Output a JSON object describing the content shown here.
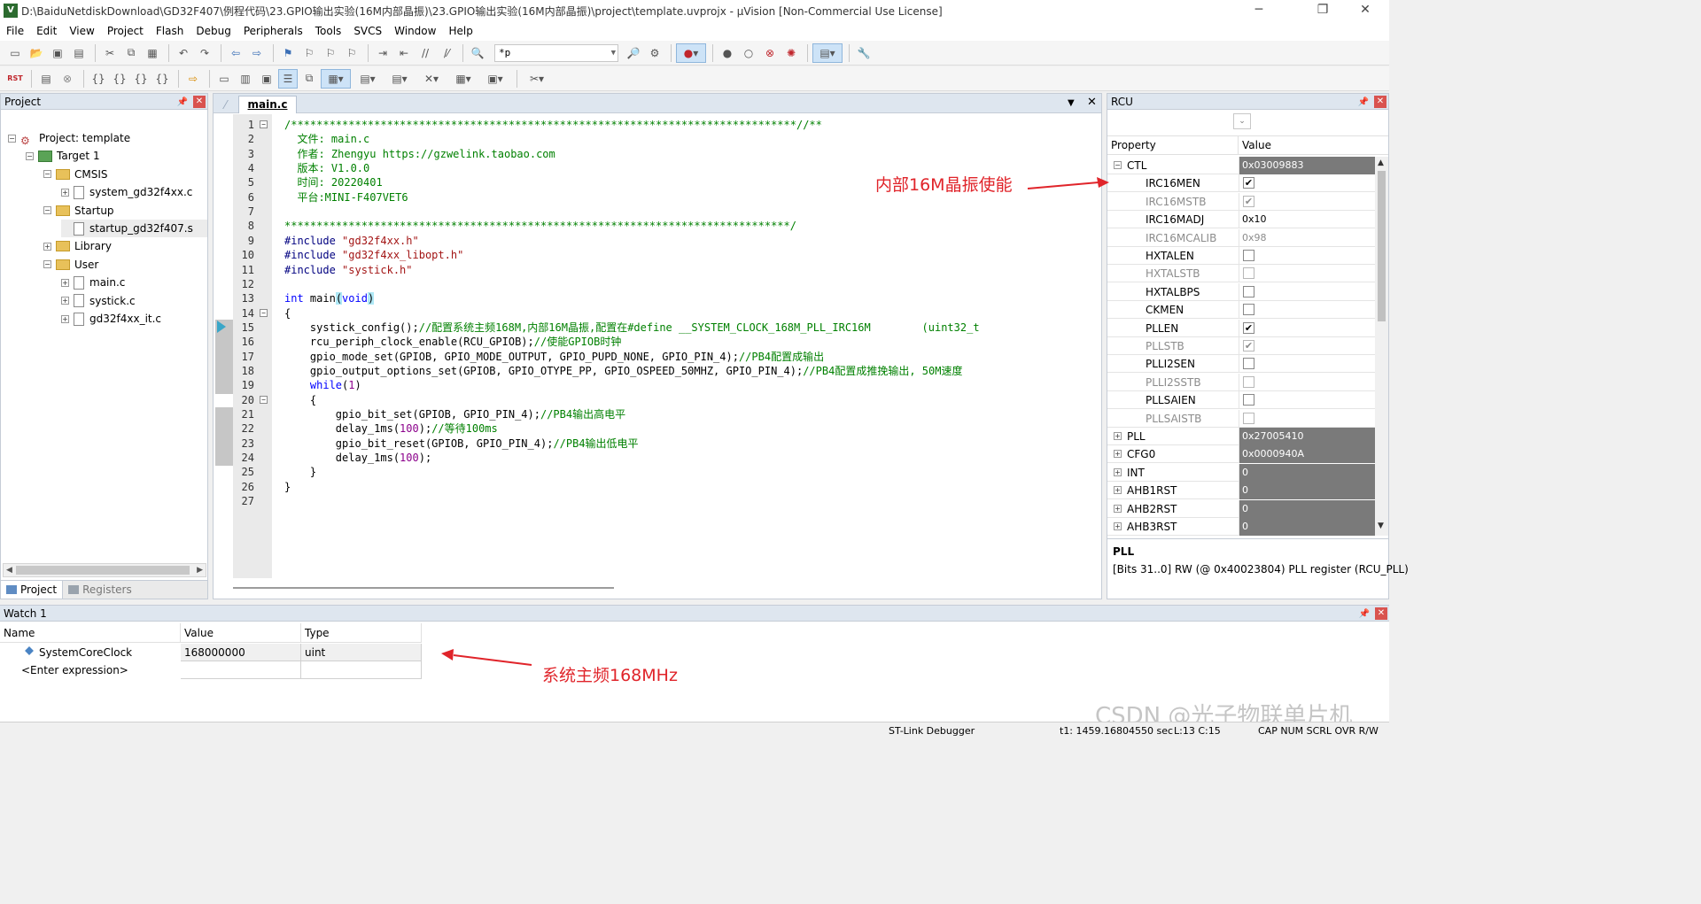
{
  "window": {
    "title": "D:\\BaiduNetdiskDownload\\GD32F407\\例程代码\\23.GPIO输出实验(16M内部晶振)\\23.GPIO输出实验(16M内部晶振)\\project\\template.uvprojx - µVision  [Non-Commercial Use License]",
    "controls": [
      "─",
      "❐",
      "✕"
    ]
  },
  "menu": [
    "File",
    "Edit",
    "View",
    "Project",
    "Flash",
    "Debug",
    "Peripherals",
    "Tools",
    "SVCS",
    "Window",
    "Help"
  ],
  "toolbar": {
    "find_combo_value": "*p",
    "reset_label": "RST"
  },
  "project_panel": {
    "title": "Project",
    "tree": [
      {
        "label": "Project: template",
        "depth": 0,
        "kind": "project",
        "expand": "⊟"
      },
      {
        "label": "Target 1",
        "depth": 1,
        "kind": "target",
        "expand": "⊟"
      },
      {
        "label": "CMSIS",
        "depth": 2,
        "kind": "folder",
        "expand": "⊟"
      },
      {
        "label": "system_gd32f4xx.c",
        "depth": 3,
        "kind": "file",
        "expand": "⊞"
      },
      {
        "label": "Startup",
        "depth": 2,
        "kind": "folder",
        "expand": "⊟"
      },
      {
        "label": "startup_gd32f407.s",
        "depth": 3,
        "kind": "file",
        "expand": ""
      },
      {
        "label": "Library",
        "depth": 2,
        "kind": "folder",
        "expand": "⊞"
      },
      {
        "label": "User",
        "depth": 2,
        "kind": "folder",
        "expand": "⊟"
      },
      {
        "label": "main.c",
        "depth": 3,
        "kind": "file",
        "expand": "⊞"
      },
      {
        "label": "systick.c",
        "depth": 3,
        "kind": "file",
        "expand": "⊞"
      },
      {
        "label": "gd32f4xx_it.c",
        "depth": 3,
        "kind": "file",
        "expand": "⊞"
      }
    ],
    "tabs": [
      "Project",
      "Registers"
    ]
  },
  "editor": {
    "tab": "main.c",
    "lines": [
      {
        "n": "1",
        "fold": "⊟",
        "parts": [
          {
            "t": "/*******************************************************************************//**",
            "c": "com"
          }
        ]
      },
      {
        "n": "2",
        "fold": "",
        "parts": [
          {
            "t": "  文件: main.c",
            "c": "com"
          }
        ]
      },
      {
        "n": "3",
        "fold": "",
        "parts": [
          {
            "t": "  作者: Zhengyu https://gzwelink.taobao.com",
            "c": "com"
          }
        ]
      },
      {
        "n": "4",
        "fold": "",
        "parts": [
          {
            "t": "  版本: V1.0.0",
            "c": "com"
          }
        ]
      },
      {
        "n": "5",
        "fold": "",
        "parts": [
          {
            "t": "  时间: 20220401",
            "c": "com"
          }
        ]
      },
      {
        "n": "6",
        "fold": "",
        "parts": [
          {
            "t": "  平台:MINI-F407VET6",
            "c": "com"
          }
        ]
      },
      {
        "n": "7",
        "fold": "",
        "parts": [
          {
            "t": "",
            "c": "com"
          }
        ]
      },
      {
        "n": "8",
        "fold": "",
        "parts": [
          {
            "t": "*******************************************************************************/",
            "c": "com"
          }
        ]
      },
      {
        "n": "9",
        "fold": "",
        "parts": [
          {
            "t": "#include ",
            "c": "pp"
          },
          {
            "t": "\"gd32f4xx.h\"",
            "c": "str"
          }
        ]
      },
      {
        "n": "10",
        "fold": "",
        "parts": [
          {
            "t": "#include ",
            "c": "pp"
          },
          {
            "t": "\"gd32f4xx_libopt.h\"",
            "c": "str"
          }
        ]
      },
      {
        "n": "11",
        "fold": "",
        "parts": [
          {
            "t": "#include ",
            "c": "pp"
          },
          {
            "t": "\"systick.h\"",
            "c": "str"
          }
        ]
      },
      {
        "n": "12",
        "fold": "",
        "parts": [
          {
            "t": "",
            "c": "txt"
          }
        ]
      },
      {
        "n": "13",
        "fold": "",
        "parts": [
          {
            "t": "int",
            "c": "kw"
          },
          {
            "t": " main",
            "c": "txt"
          },
          {
            "t": "(",
            "c": "hl"
          },
          {
            "t": "void",
            "c": "kw"
          },
          {
            "t": ")",
            "c": "hl"
          }
        ]
      },
      {
        "n": "14",
        "fold": "⊟",
        "parts": [
          {
            "t": "{",
            "c": "txt"
          }
        ]
      },
      {
        "n": "15",
        "fold": "",
        "parts": [
          {
            "t": "    systick_config();",
            "c": "txt"
          },
          {
            "t": "//配置系统主频168M,内部16M晶振,配置在#define __SYSTEM_CLOCK_168M_PLL_IRC16M        (uint32_t",
            "c": "com"
          }
        ]
      },
      {
        "n": "16",
        "fold": "",
        "parts": [
          {
            "t": "    rcu_periph_clock_enable(RCU_GPIOB);",
            "c": "txt"
          },
          {
            "t": "//使能GPIOB时钟",
            "c": "com"
          }
        ]
      },
      {
        "n": "17",
        "fold": "",
        "parts": [
          {
            "t": "    gpio_mode_set(GPIOB, GPIO_MODE_OUTPUT, GPIO_PUPD_NONE, GPIO_PIN_4);",
            "c": "txt"
          },
          {
            "t": "//PB4配置成输出",
            "c": "com"
          }
        ]
      },
      {
        "n": "18",
        "fold": "",
        "parts": [
          {
            "t": "    gpio_output_options_set(GPIOB, GPIO_OTYPE_PP, GPIO_OSPEED_50MHZ, GPIO_PIN_4);",
            "c": "txt"
          },
          {
            "t": "//PB4配置成推挽输出, 50M速度",
            "c": "com"
          }
        ]
      },
      {
        "n": "19",
        "fold": "",
        "parts": [
          {
            "t": "    ",
            "c": "txt"
          },
          {
            "t": "while",
            "c": "kw"
          },
          {
            "t": "(",
            "c": "txt"
          },
          {
            "t": "1",
            "c": "num"
          },
          {
            "t": ")",
            "c": "txt"
          }
        ]
      },
      {
        "n": "20",
        "fold": "⊟",
        "parts": [
          {
            "t": "    {",
            "c": "txt"
          }
        ]
      },
      {
        "n": "21",
        "fold": "",
        "parts": [
          {
            "t": "        gpio_bit_set(GPIOB, GPIO_PIN_4);",
            "c": "txt"
          },
          {
            "t": "//PB4输出高电平",
            "c": "com"
          }
        ]
      },
      {
        "n": "22",
        "fold": "",
        "parts": [
          {
            "t": "        delay_1ms(",
            "c": "txt"
          },
          {
            "t": "100",
            "c": "num"
          },
          {
            "t": ");",
            "c": "txt"
          },
          {
            "t": "//等待100ms",
            "c": "com"
          }
        ]
      },
      {
        "n": "23",
        "fold": "",
        "parts": [
          {
            "t": "        gpio_bit_reset(GPIOB, GPIO_PIN_4);",
            "c": "txt"
          },
          {
            "t": "//PB4输出低电平",
            "c": "com"
          }
        ]
      },
      {
        "n": "24",
        "fold": "",
        "parts": [
          {
            "t": "        delay_1ms(",
            "c": "txt"
          },
          {
            "t": "100",
            "c": "num"
          },
          {
            "t": ");",
            "c": "txt"
          }
        ]
      },
      {
        "n": "25",
        "fold": "",
        "parts": [
          {
            "t": "    }",
            "c": "txt"
          }
        ]
      },
      {
        "n": "26",
        "fold": "",
        "parts": [
          {
            "t": "}",
            "c": "txt"
          }
        ]
      },
      {
        "n": "27",
        "fold": "",
        "parts": [
          {
            "t": "",
            "c": "txt"
          }
        ]
      }
    ]
  },
  "rcu_panel": {
    "title": "RCU",
    "col_property": "Property",
    "col_value": "Value",
    "rows": [
      {
        "name": "CTL",
        "level": 0,
        "expand": "⊟",
        "value": "0x03009883",
        "vstyle": "dark",
        "enabled": true
      },
      {
        "name": "IRC16MEN",
        "level": 1,
        "check": true,
        "enabled": true
      },
      {
        "name": "IRC16MSTB",
        "level": 1,
        "check": true,
        "enabled": false
      },
      {
        "name": "IRC16MADJ",
        "level": 1,
        "value": "0x10",
        "vstyle": "",
        "enabled": true
      },
      {
        "name": "IRC16MCALIB",
        "level": 1,
        "value": "0x98",
        "vstyle": "grey",
        "enabled": false
      },
      {
        "name": "HXTALEN",
        "level": 1,
        "check": false,
        "enabled": true
      },
      {
        "name": "HXTALSTB",
        "level": 1,
        "check": false,
        "enabled": false
      },
      {
        "name": "HXTALBPS",
        "level": 1,
        "check": false,
        "enabled": true
      },
      {
        "name": "CKMEN",
        "level": 1,
        "check": false,
        "enabled": true
      },
      {
        "name": "PLLEN",
        "level": 1,
        "check": true,
        "enabled": true
      },
      {
        "name": "PLLSTB",
        "level": 1,
        "check": true,
        "enabled": false
      },
      {
        "name": "PLLI2SEN",
        "level": 1,
        "check": false,
        "enabled": true
      },
      {
        "name": "PLLI2SSTB",
        "level": 1,
        "check": false,
        "enabled": false
      },
      {
        "name": "PLLSAIEN",
        "level": 1,
        "check": false,
        "enabled": true
      },
      {
        "name": "PLLSAISTB",
        "level": 1,
        "check": false,
        "enabled": false
      },
      {
        "name": "PLL",
        "level": 0,
        "expand": "⊞",
        "value": "0x27005410",
        "vstyle": "dark",
        "enabled": true
      },
      {
        "name": "CFG0",
        "level": 0,
        "expand": "⊞",
        "value": "0x0000940A",
        "vstyle": "dark",
        "enabled": true
      },
      {
        "name": "INT",
        "level": 0,
        "expand": "⊞",
        "value": "0",
        "vstyle": "dark",
        "enabled": true
      },
      {
        "name": "AHB1RST",
        "level": 0,
        "expand": "⊞",
        "value": "0",
        "vstyle": "dark",
        "enabled": true
      },
      {
        "name": "AHB2RST",
        "level": 0,
        "expand": "⊞",
        "value": "0",
        "vstyle": "dark",
        "enabled": true
      },
      {
        "name": "AHB3RST",
        "level": 0,
        "expand": "⊞",
        "value": "0",
        "vstyle": "dark",
        "enabled": true
      }
    ],
    "desc_name": "PLL",
    "desc_text": "[Bits 31..0] RW (@ 0x40023804) PLL register (RCU_PLL)"
  },
  "watch": {
    "title": "Watch 1",
    "col_name": "Name",
    "col_value": "Value",
    "col_type": "Type",
    "rows": [
      {
        "name": "SystemCoreClock",
        "value": "168000000",
        "type": "uint"
      },
      {
        "name": "<Enter expression>",
        "value": "",
        "type": ""
      }
    ]
  },
  "annotations": {
    "rcu_note": "内部16M晶振使能",
    "watch_note": "系统主频168MHz",
    "color": "#e0242a"
  },
  "status": {
    "debugger": "ST-Link Debugger",
    "time": "t1: 1459.16804550 sec",
    "position": "L:13 C:15",
    "flags": "CAP  NUM  SCRL  OVR  R/W"
  },
  "watermark": "CSDN @光子物联单片机"
}
